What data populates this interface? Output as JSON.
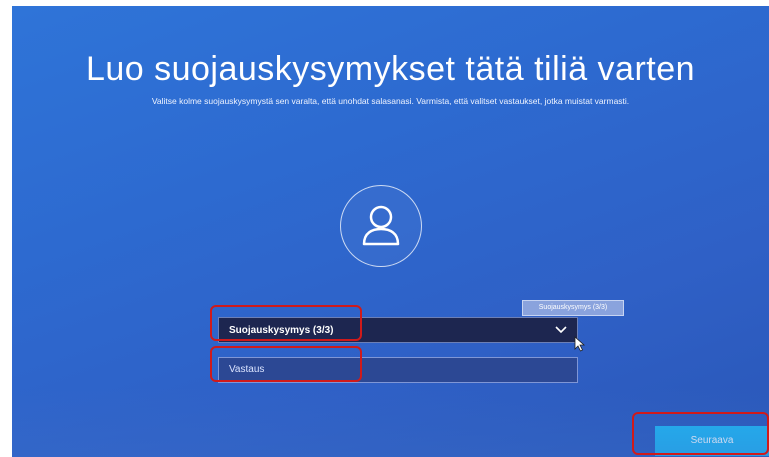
{
  "setup": {
    "title": "Luo suojauskysymykset tätä tiliä varten",
    "subtitle": "Valitse kolme suojauskysymystä sen varalta, että unohdat salasanasi. Varmista, että valitset vastaukset, jotka muistat varmasti.",
    "avatar_icon": "user-icon",
    "question_dropdown": {
      "selected": "Suojauskysymys (3/3)",
      "tooltip": "Suojauskysymys (3/3)",
      "icon": "chevron-down-icon"
    },
    "answer_field": {
      "placeholder": "Vastaus"
    },
    "next_button_label": "Seuraava"
  },
  "colors": {
    "background": "#2f6ad0",
    "dropdown_bg": "#1d2650",
    "answer_bg": "#2c4894",
    "button_accent": "#1fb6f2",
    "annotation_red": "#d01a1a"
  }
}
